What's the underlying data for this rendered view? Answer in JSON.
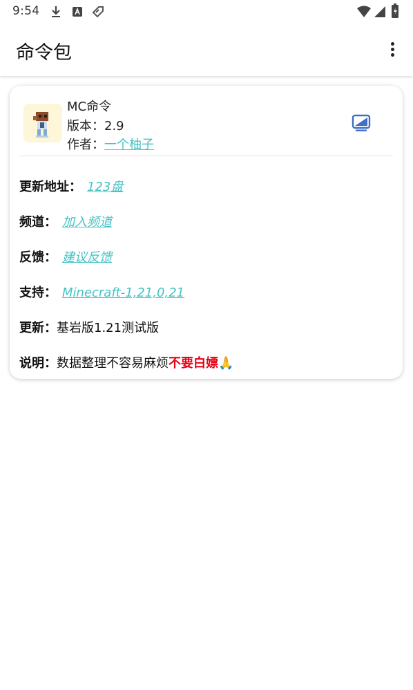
{
  "status_bar": {
    "time": "9:54"
  },
  "app_bar": {
    "title": "命令包"
  },
  "card": {
    "name": "MC命令",
    "version_label": "版本：",
    "version": "2.9",
    "author_label": "作者：",
    "author": "一个柚子",
    "rows": {
      "update_url": {
        "label": "更新地址：",
        "value": "123盘"
      },
      "channel": {
        "label": "频道：",
        "value": "加入频道"
      },
      "feedback": {
        "label": "反馈：",
        "value": "建议反馈"
      },
      "support": {
        "label": "支持：",
        "value": "Minecraft-1,21,0,21"
      },
      "update": {
        "label": "更新：",
        "value": "基岩版1.21测试版"
      },
      "note": {
        "label": "说明：",
        "value": "数据整理不容易麻烦",
        "highlight": "不要白嫖",
        "emoji": "🙏"
      }
    }
  },
  "colors": {
    "link": "#47c3c4",
    "highlight": "#e60012",
    "tv_icon": "#3f6fc6"
  },
  "icons": [
    "download-icon",
    "a-box-icon",
    "tag-icon",
    "wifi-icon",
    "signal-icon",
    "battery-icon",
    "more-vert-icon",
    "tv-icon"
  ]
}
